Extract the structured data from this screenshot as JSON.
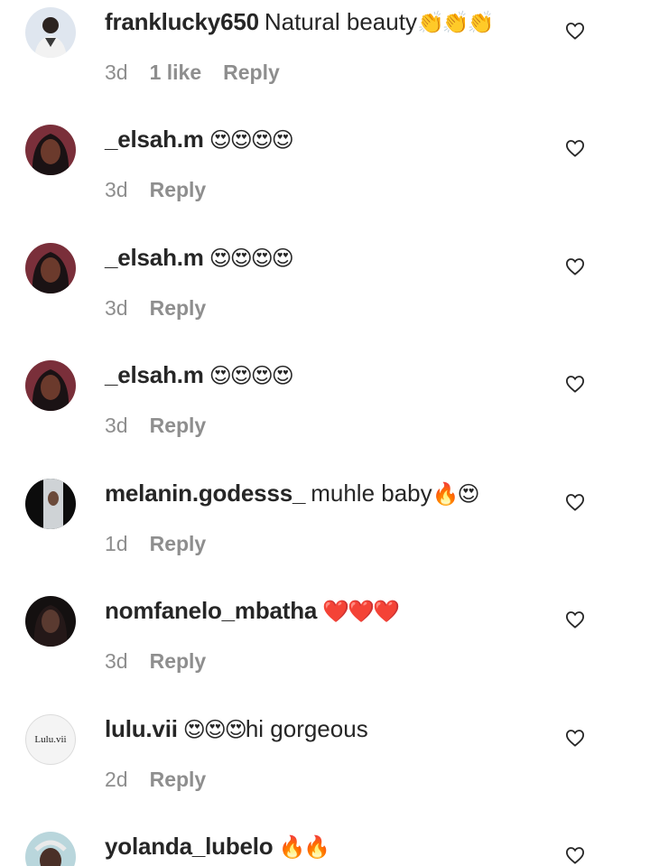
{
  "comments": [
    {
      "username": "franklucky650",
      "text": "Natural beauty",
      "emoji": "👏👏👏",
      "time": "3d",
      "likes": "1 like",
      "reply": "Reply",
      "avatar": "photo-man"
    },
    {
      "username": "_elsah.m",
      "text": "",
      "emoji": "😍😍😍😍",
      "time": "3d",
      "likes": "",
      "reply": "Reply",
      "avatar": "photo-woman"
    },
    {
      "username": "_elsah.m",
      "text": "",
      "emoji": "😍😍😍😍",
      "time": "3d",
      "likes": "",
      "reply": "Reply",
      "avatar": "photo-woman"
    },
    {
      "username": "_elsah.m",
      "text": "",
      "emoji": "😍😍😍😍",
      "time": "3d",
      "likes": "",
      "reply": "Reply",
      "avatar": "photo-woman"
    },
    {
      "username": "melanin.godesss_",
      "text": "muhle baby",
      "emoji": "🔥😍",
      "time": "1d",
      "likes": "",
      "reply": "Reply",
      "avatar": "photo-mirror"
    },
    {
      "username": "nomfanelo_mbatha",
      "text": "",
      "emoji": "❤️❤️❤️",
      "time": "3d",
      "likes": "",
      "reply": "Reply",
      "avatar": "photo-dark"
    },
    {
      "username": "lulu.vii",
      "text": "hi gorgeous",
      "emoji": "😍😍😍",
      "time": "2d",
      "likes": "",
      "reply": "Reply",
      "avatar": "text",
      "avatar_text": "Lulu.vii"
    },
    {
      "username": "yolanda_lubelo",
      "text": "",
      "emoji": "🔥🔥",
      "time": "",
      "likes": "",
      "reply": "",
      "avatar": "photo-light"
    }
  ],
  "colors": {
    "username": "#262626",
    "meta": "#8e8e8e",
    "heart_stroke": "#262626"
  }
}
